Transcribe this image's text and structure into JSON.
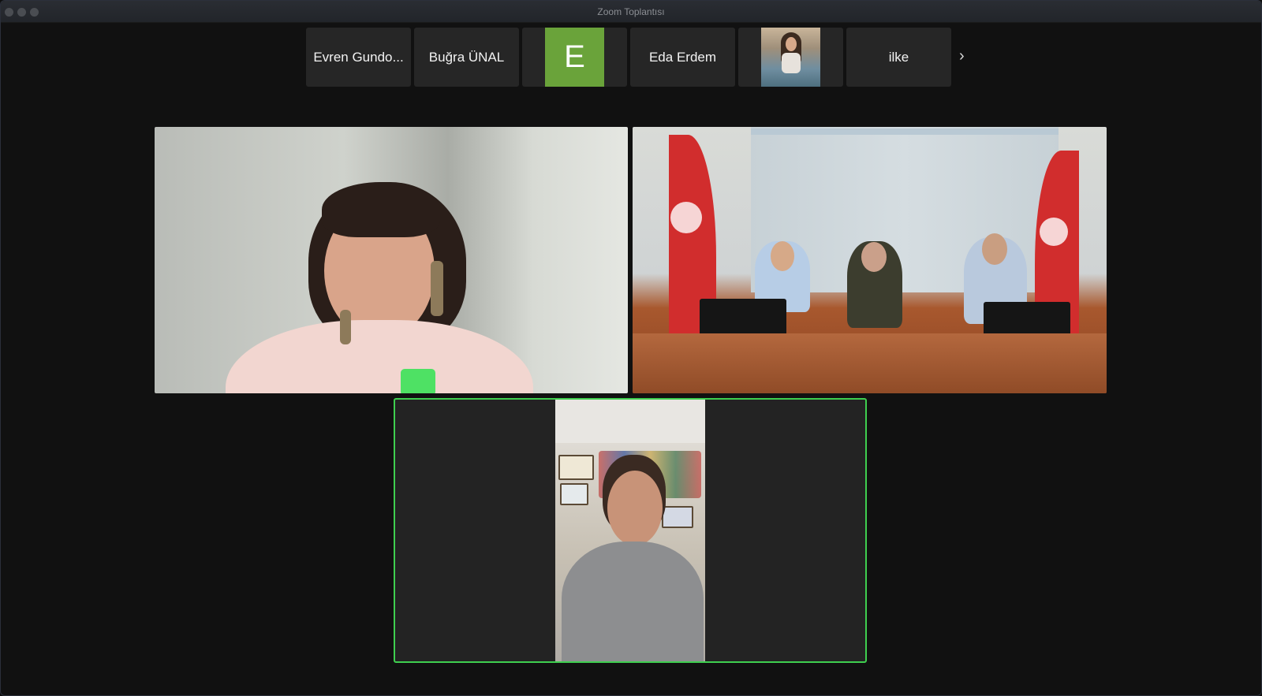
{
  "window": {
    "title": "Zoom Toplantısı"
  },
  "participant_strip": {
    "tiles": [
      {
        "kind": "name",
        "label": "Evren Gundo..."
      },
      {
        "kind": "name",
        "label": "Buğra ÜNAL"
      },
      {
        "kind": "avatar-letter",
        "label": "E",
        "color": "#6aa33a"
      },
      {
        "kind": "name",
        "label": "Eda Erdem"
      },
      {
        "kind": "avatar-photo"
      },
      {
        "kind": "name",
        "label": "ilke"
      }
    ],
    "next_icon": "chevron-right-icon"
  },
  "video_tiles": {
    "active_speaker_border_color": "#3fcf4f"
  }
}
